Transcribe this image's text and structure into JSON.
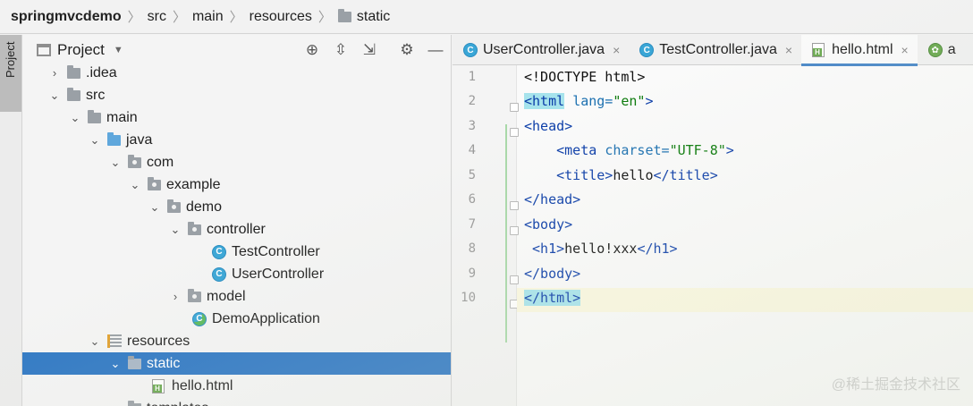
{
  "breadcrumb": {
    "items": [
      "springmvcdemo",
      "src",
      "main",
      "resources",
      "static"
    ]
  },
  "left_stripe": {
    "project_tab": "Project"
  },
  "project_panel": {
    "title": "Project",
    "tree": [
      {
        "label": ".idea",
        "icon": "folder-icon",
        "expanded": false
      },
      {
        "label": "src",
        "icon": "folder-icon",
        "expanded": true
      },
      {
        "label": "main",
        "icon": "folder-icon",
        "expanded": true
      },
      {
        "label": "java",
        "icon": "source-folder-icon",
        "expanded": true
      },
      {
        "label": "com",
        "icon": "package-icon",
        "expanded": true
      },
      {
        "label": "example",
        "icon": "package-icon",
        "expanded": true
      },
      {
        "label": "demo",
        "icon": "package-icon",
        "expanded": true
      },
      {
        "label": "controller",
        "icon": "package-icon",
        "expanded": true
      },
      {
        "label": "TestController",
        "icon": "java-class-icon"
      },
      {
        "label": "UserController",
        "icon": "java-class-icon"
      },
      {
        "label": "model",
        "icon": "package-icon",
        "expanded": false
      },
      {
        "label": "DemoApplication",
        "icon": "spring-boot-class-icon"
      },
      {
        "label": "resources",
        "icon": "resources-folder-icon",
        "expanded": true
      },
      {
        "label": "static",
        "icon": "folder-icon",
        "expanded": true,
        "selected": true
      },
      {
        "label": "hello.html",
        "icon": "html-file-icon"
      },
      {
        "label": "templates",
        "icon": "folder-icon",
        "expanded": false
      }
    ]
  },
  "editor": {
    "tabs": [
      {
        "label": "UserController.java",
        "icon": "java-class-icon",
        "active": false
      },
      {
        "label": "TestController.java",
        "icon": "java-class-icon",
        "active": false
      },
      {
        "label": "hello.html",
        "icon": "html-file-icon",
        "active": true
      },
      {
        "label": "a",
        "icon": "spring-icon",
        "active": false
      }
    ],
    "line_numbers": [
      "1",
      "2",
      "3",
      "4",
      "5",
      "6",
      "7",
      "8",
      "9",
      "10"
    ],
    "lines": [
      "<!DOCTYPE html>",
      "<html lang=\"en\">",
      "<head>",
      "    <meta charset=\"UTF-8\">",
      "    <title>hello</title>",
      "</head>",
      "<body>",
      " <h1>hello!xxx</h1>",
      "</body>",
      "</html>"
    ]
  },
  "watermark": "@稀土掘金技术社区",
  "colors": {
    "selection": "#2f78c4",
    "tag": "#0a3ca8",
    "string": "#0a7a0a",
    "match_highlight": "#a6e3ec"
  }
}
